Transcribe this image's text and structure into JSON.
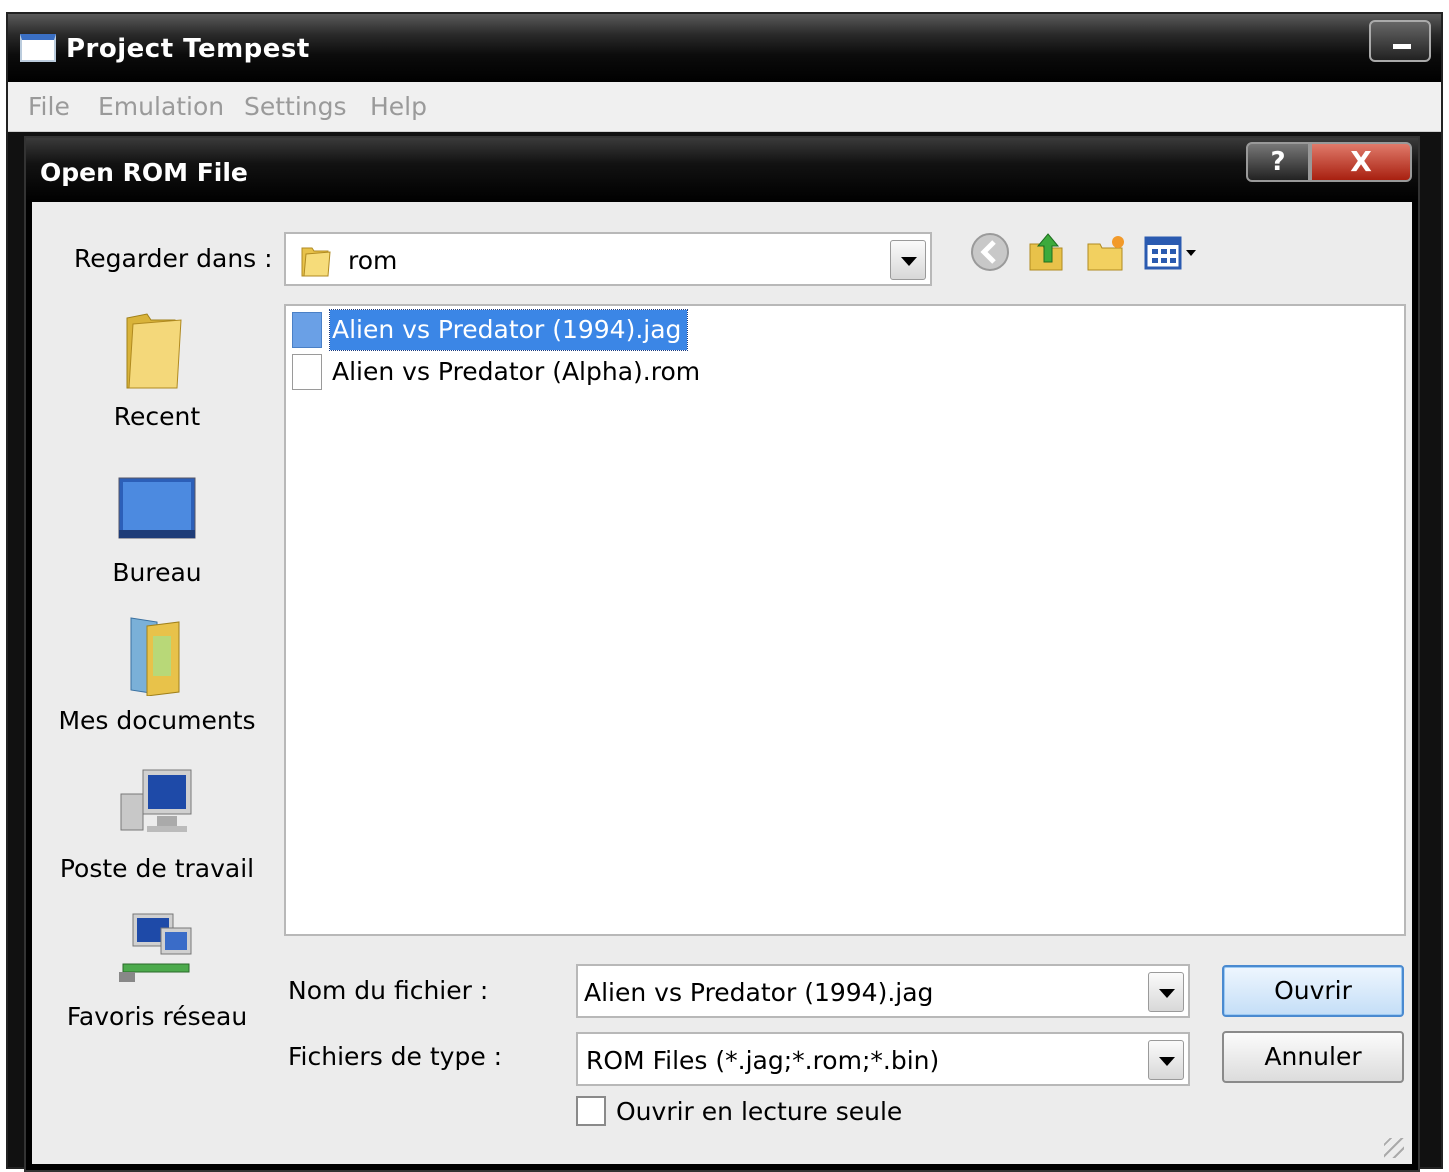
{
  "app": {
    "title": "Project Tempest",
    "menu": [
      "File",
      "Emulation",
      "Settings",
      "Help"
    ]
  },
  "dialog": {
    "title": "Open ROM File",
    "help_label": "?",
    "close_label": "X",
    "look_in_label": "Regarder dans :",
    "look_in_value": "rom",
    "places": [
      {
        "label": "Recent",
        "icon": "recent-folder-icon"
      },
      {
        "label": "Bureau",
        "icon": "desktop-icon"
      },
      {
        "label": "Mes documents",
        "icon": "documents-icon"
      },
      {
        "label": "Poste de travail",
        "icon": "computer-icon"
      },
      {
        "label": "Favoris réseau",
        "icon": "network-icon"
      }
    ],
    "files": [
      {
        "name": "Alien vs Predator (1994).jag",
        "selected": true
      },
      {
        "name": "Alien vs Predator (Alpha).rom",
        "selected": false
      }
    ],
    "filename_label": "Nom du fichier :",
    "filename_value": "Alien vs Predator (1994).jag",
    "filetype_label": "Fichiers de type :",
    "filetype_value": "ROM Files (*.jag;*.rom;*.bin)",
    "open_label": "Ouvrir",
    "cancel_label": "Annuler",
    "readonly_label": "Ouvrir en lecture seule",
    "readonly_checked": false
  },
  "colors": {
    "selection": "#3b86e6",
    "dialog_bg": "#ececec",
    "titlebar": "#000000"
  }
}
